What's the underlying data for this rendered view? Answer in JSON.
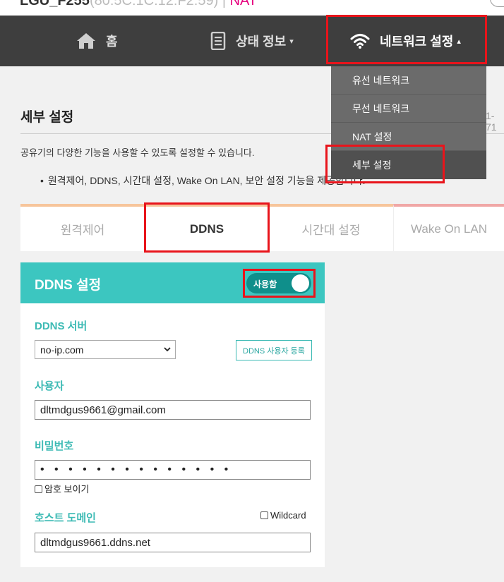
{
  "header": {
    "device_name": "LGU_F255",
    "mac": "(80:5C:1C:12:F2:59)",
    "separator": "|",
    "mode": "NAT"
  },
  "nav": {
    "home_label": "홈",
    "status_label": "상태 정보",
    "network_label": "네트워크 설정",
    "status_caret": "▾",
    "network_caret": "▴"
  },
  "dropdown": {
    "items": [
      "유선 네트워크",
      "무선 네트워크",
      "NAT 설정",
      "세부 설정"
    ],
    "active": "세부 설정"
  },
  "page": {
    "title": "세부 설정",
    "right_cut": "1-71",
    "description": "공유기의 다양한 기능을 사용할 수 있도록 설정할 수 있습니다.",
    "bullet_dot": "•",
    "bullet": "원격제어, DDNS, 시간대 설정, Wake On LAN, 보안 설정 기능을 제공합니다."
  },
  "tabs": {
    "items": [
      "원격제어",
      "DDNS",
      "시간대 설정",
      "Wake On LAN"
    ],
    "active": "DDNS"
  },
  "ddns": {
    "title": "DDNS 설정",
    "toggle_label": "사용함",
    "toggle_on": true,
    "server_label": "DDNS 서버",
    "server_value": "no-ip.com",
    "register_button": "DDNS 사용자 등록",
    "user_label": "사용자",
    "user_value": "dltmdgus9661@gmail.com",
    "password_label": "비밀번호",
    "password_value": "• • • • • • • • • • • • • •",
    "show_password_label": "암호 보이기",
    "host_label": "호스트 도메인",
    "wildcard_label": "Wildcard",
    "host_value": "dltmdgus9661.ddns.net"
  },
  "colors": {
    "navbar": "#3e3e3e",
    "accent_teal": "#3cc6c0",
    "highlight_red": "#e8141b",
    "brand_pink": "#e6007e"
  }
}
